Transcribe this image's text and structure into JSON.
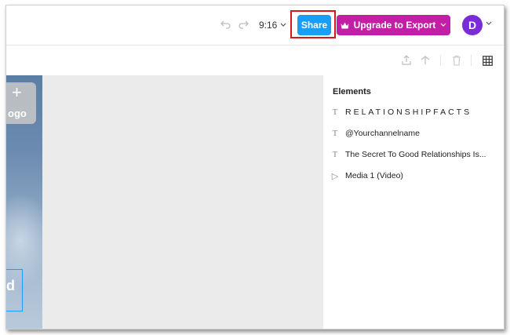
{
  "header": {
    "undo_icon": "undo-icon",
    "redo_icon": "redo-icon",
    "aspect_ratio": "9:16",
    "share_label": "Share",
    "upgrade_label": "Upgrade to Export",
    "upgrade_icon": "crown-icon",
    "avatar_initial": "D"
  },
  "toolbar": {
    "icons": [
      "bring-forward-icon",
      "send-backward-icon",
      "delete-icon",
      "grid-icon"
    ]
  },
  "canvas": {
    "logo_label": "ogo",
    "frame_letter": "d"
  },
  "elements_panel": {
    "title": "Elements",
    "items": [
      {
        "type": "text",
        "icon": "T",
        "label": "RELATIONSHIPFACTS"
      },
      {
        "type": "text",
        "icon": "T",
        "label": "@Yourchannelname"
      },
      {
        "type": "text",
        "icon": "T",
        "label": "The Secret To Good Relationships Is..."
      },
      {
        "type": "video",
        "icon": "▷",
        "label": "Media 1 (Video)"
      }
    ]
  },
  "colors": {
    "share": "#1a9ef5",
    "upgrade": "#c21fa6",
    "avatar": "#7b2cd6",
    "highlight": "#d7171f"
  }
}
